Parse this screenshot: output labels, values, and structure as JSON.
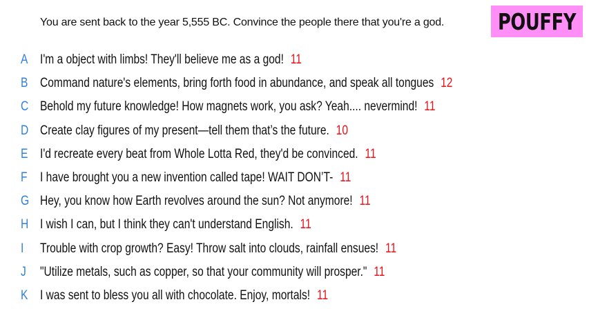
{
  "prompt": "You are sent back to the year 5,555 BC. Convince the people there that you're a god.",
  "logo": "POUFFY",
  "colors": {
    "letter": "#2f7fe0",
    "score": "#e8121b",
    "logo_bg": "#ff8ef6",
    "text": "#111111"
  },
  "answers": [
    {
      "letter": "A",
      "text": "I'm a object with limbs! They'll believe me as a god!",
      "score": "11"
    },
    {
      "letter": "B",
      "text": "Command nature's elements, bring forth food in abundance, and speak all tongues",
      "score": "12"
    },
    {
      "letter": "C",
      "text": "Behold my future knowledge! How magnets work, you ask? Yeah.... nevermind!",
      "score": "11"
    },
    {
      "letter": "D",
      "text": "Create clay figures of my present—tell them that’s the future.",
      "score": "10"
    },
    {
      "letter": "E",
      "text": "I'd recreate every beat from Whole Lotta Red, they'd be convinced.",
      "score": "11"
    },
    {
      "letter": "F",
      "text": "I have brought you a new invention called tape! WAIT DON’T-",
      "score": "11"
    },
    {
      "letter": "G",
      "text": "Hey, you know how Earth revolves around the sun? Not anymore!",
      "score": "11"
    },
    {
      "letter": "H",
      "text": "I wish I can, but I think they can't understand English.",
      "score": "11"
    },
    {
      "letter": "I",
      "text": "Trouble with crop growth? Easy! Throw salt into clouds, rainfall ensues!",
      "score": "11"
    },
    {
      "letter": "J",
      "text": "\"Utilize metals, such as copper, so that your community will prosper.\"",
      "score": "11"
    },
    {
      "letter": "K",
      "text": "I was sent to bless you all with chocolate. Enjoy, mortals!",
      "score": "11"
    }
  ]
}
